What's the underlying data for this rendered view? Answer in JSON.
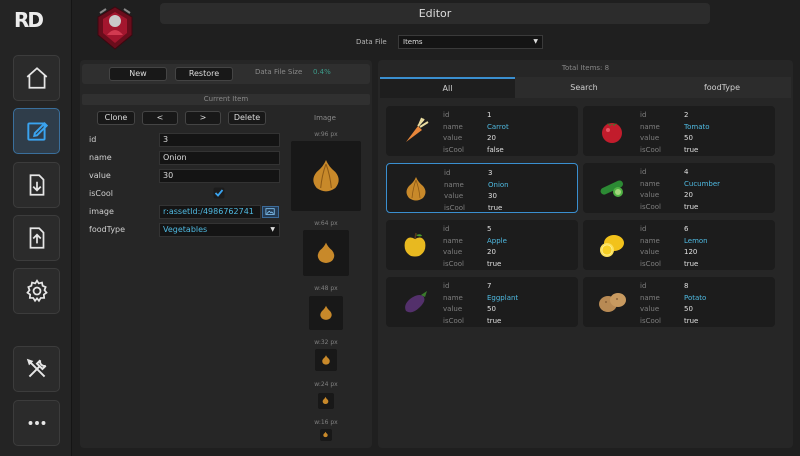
{
  "app": {
    "logo": "RD",
    "title": "Editor"
  },
  "data_file": {
    "label": "Data File",
    "value": "Items"
  },
  "toolbar": {
    "new_label": "New",
    "restore_label": "Restore",
    "size_label": "Data File Size",
    "size_value": "0.4%"
  },
  "current_item": {
    "header": "Current Item",
    "buttons": {
      "clone": "Clone",
      "prev": "<",
      "next": ">",
      "delete": "Delete"
    },
    "fields": {
      "id": {
        "label": "id",
        "value": "3"
      },
      "name": {
        "label": "name",
        "value": "Onion"
      },
      "value": {
        "label": "value",
        "value": "30"
      },
      "isCool": {
        "label": "isCool",
        "checked": true
      },
      "image": {
        "label": "image",
        "value": "r:assetId:/4986762741"
      },
      "foodType": {
        "label": "foodType",
        "value": "Vegetables"
      }
    }
  },
  "preview": {
    "title": "Image",
    "sizes": [
      "w:96 px",
      "w:64 px",
      "w:48 px",
      "w:32 px",
      "w:24 px",
      "w:16 px"
    ]
  },
  "list": {
    "total": "Total Items: 8",
    "tabs": [
      "All",
      "Search",
      "foodType"
    ],
    "keys": [
      "id",
      "name",
      "value",
      "isCool"
    ],
    "items": [
      {
        "id": "1",
        "name": "Carrot",
        "value": "20",
        "isCool": "false",
        "icon": "carrot-icon"
      },
      {
        "id": "2",
        "name": "Tomato",
        "value": "50",
        "isCool": "true",
        "icon": "tomato-icon"
      },
      {
        "id": "3",
        "name": "Onion",
        "value": "30",
        "isCool": "true",
        "icon": "onion-icon"
      },
      {
        "id": "4",
        "name": "Cucumber",
        "value": "20",
        "isCool": "true",
        "icon": "cucumber-icon"
      },
      {
        "id": "5",
        "name": "Apple",
        "value": "20",
        "isCool": "true",
        "icon": "apple-icon"
      },
      {
        "id": "6",
        "name": "Lemon",
        "value": "120",
        "isCool": "true",
        "icon": "lemon-icon"
      },
      {
        "id": "7",
        "name": "Eggplant",
        "value": "50",
        "isCool": "true",
        "icon": "eggplant-icon"
      },
      {
        "id": "8",
        "name": "Potato",
        "value": "50",
        "isCool": "true",
        "icon": "potato-icon"
      }
    ]
  },
  "colors": {
    "accent": "#3a8fd0",
    "link": "#4fb9e0",
    "size_value": "#3d9b8a"
  }
}
